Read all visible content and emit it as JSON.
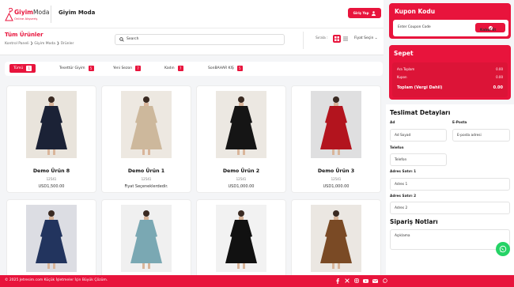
{
  "header": {
    "logo_main": "Giyim",
    "logo_accent": "Moda",
    "logo_tagline": "Online Alışveriş",
    "store_name": "Giyim Moda",
    "login_label": "Giriş Yap"
  },
  "page": {
    "title": "Tüm Ürünler",
    "breadcrumb": [
      "Kontrol Paneli",
      "Giyim Moda",
      "Ürünler"
    ],
    "search_placeholder": "Search",
    "sort_label": "Sırala :",
    "price_select": "Fiyat Seçin"
  },
  "tabs": [
    {
      "label": "Tümü",
      "count": "1",
      "active": true
    },
    {
      "label": "Tesettür Giyim",
      "count": "5"
    },
    {
      "label": "Yeni Sezon",
      "count": "7"
    },
    {
      "label": "Kadın",
      "count": "7"
    },
    {
      "label": "SonBAHAR KIŞ",
      "count": "5"
    }
  ],
  "products": [
    {
      "name": "Demo Ürün 8",
      "sku": "12541",
      "price": "USD1,500.00",
      "dress_color": "#1b2236",
      "bg": "#e9e4dc"
    },
    {
      "name": "Demo Ürün 1",
      "sku": "12541",
      "price": "Fiyat Seçeneklerdedir.",
      "dress_color": "#cdb89c",
      "bg": "#ede8e1"
    },
    {
      "name": "Demo Ürün 2",
      "sku": "12541",
      "price": "USD1,000.00",
      "dress_color": "#151515",
      "bg": "#ece8e2"
    },
    {
      "name": "Demo Ürün 3",
      "sku": "12541",
      "price": "USD1,000.00",
      "dress_color": "#b3141e",
      "bg": "#dfdfe0"
    },
    {
      "name": "",
      "sku": "",
      "price": "",
      "dress_color": "#22345e",
      "bg": "#dcdde3"
    },
    {
      "name": "",
      "sku": "",
      "price": "",
      "dress_color": "#7aa8b3",
      "bg": "#f0f0f0"
    },
    {
      "name": "",
      "sku": "",
      "price": "",
      "dress_color": "#111111",
      "bg": "#f2f2f2"
    },
    {
      "name": "",
      "sku": "",
      "price": "",
      "dress_color": "#7a4a25",
      "bg": "#ebe7e2"
    }
  ],
  "coupon": {
    "title": "Kupon Kodu",
    "placeholder": "Enter Coupon Code",
    "apply_label": "Kabul Et"
  },
  "cart": {
    "title": "Sepet",
    "rows": [
      {
        "label": "Ara Toplam",
        "value": "0.00"
      },
      {
        "label": "Kupon",
        "value": "0.00"
      }
    ],
    "total_label": "Toplam (Vergi Dahil)",
    "total_value": "0.00"
  },
  "shipping": {
    "title": "Teslimat Detayları",
    "name_label": "Ad",
    "name_placeholder": "Ad Soyad",
    "email_label": "E-Posta",
    "email_placeholder": "E-posta adresi",
    "phone_label": "Telefon",
    "phone_placeholder": "Telefon",
    "addr1_label": "Adres Satırı 1",
    "addr1_placeholder": "Adres 1",
    "addr2_label": "Adres Satırı 2",
    "addr2_placeholder": "Adres 2",
    "notes_title": "Sipariş Notları",
    "notes_placeholder": "Açıklama"
  },
  "footer": {
    "text": "© 2025 Jetresim.com Küçük İşletmeler İçin Büyük Çözüm."
  },
  "colors": {
    "accent": "#e8143c",
    "whatsapp": "#25d366"
  }
}
